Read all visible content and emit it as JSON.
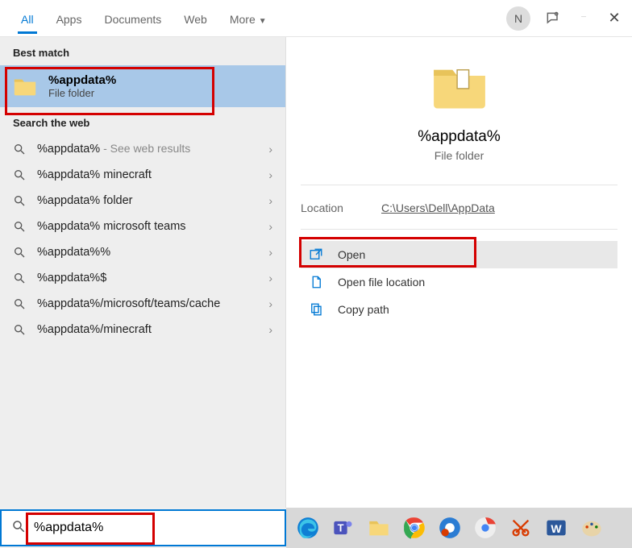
{
  "header": {
    "tabs": [
      "All",
      "Apps",
      "Documents",
      "Web",
      "More"
    ],
    "avatar_initial": "N"
  },
  "left": {
    "best_match_label": "Best match",
    "best_match": {
      "title": "%appdata%",
      "subtitle": "File folder"
    },
    "search_web_label": "Search the web",
    "suggestions": [
      {
        "text": "%appdata%",
        "hint": " - See web results"
      },
      {
        "text": "%appdata% minecraft"
      },
      {
        "text": "%appdata% folder"
      },
      {
        "text": "%appdata% microsoft teams"
      },
      {
        "text": "%appdata%%"
      },
      {
        "text": "%appdata%$"
      },
      {
        "text": "%appdata%/microsoft/teams/cache"
      },
      {
        "text": "%appdata%/minecraft"
      }
    ]
  },
  "right": {
    "title": "%appdata%",
    "subtitle": "File folder",
    "location_label": "Location",
    "location_value": "C:\\Users\\Dell\\AppData",
    "actions": {
      "open": "Open",
      "open_location": "Open file location",
      "copy_path": "Copy path"
    }
  },
  "search": {
    "value": "%appdata%"
  }
}
